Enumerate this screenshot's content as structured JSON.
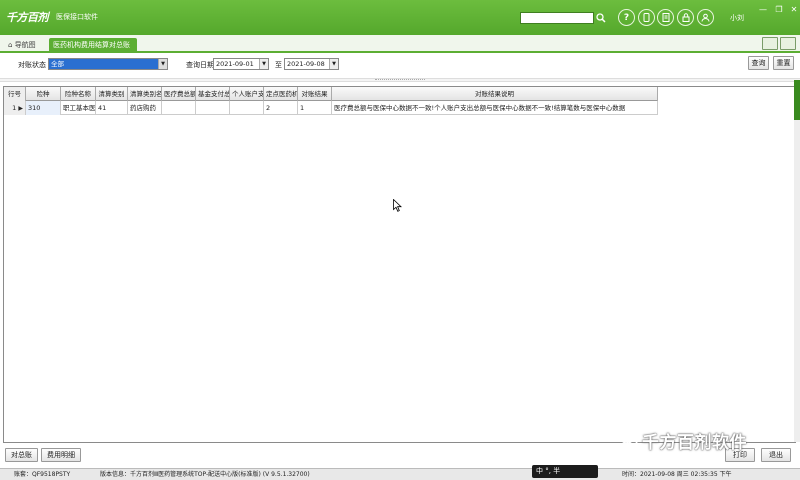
{
  "app": {
    "logo": "千方百剂",
    "subtitle": "医保接口软件",
    "user": "小刘"
  },
  "tabs": {
    "home": "导航图",
    "active": "医药机构费用结算对总账"
  },
  "filters": {
    "status_label": "对账状态",
    "status_value": "全部",
    "date_label": "查询日期",
    "date_from": "2021-09-01",
    "to_label": "至",
    "date_to": "2021-09-08",
    "query_button": "查询",
    "reset_button": "重置"
  },
  "grid": {
    "columns": [
      "行号",
      "险种",
      "险种名称",
      "清算类别",
      "清算类别名称",
      "医疗费总额",
      "基金支付总额",
      "个人账户支付总额",
      "定点医药机构结算笔数",
      "对账结果",
      "对账结果说明"
    ],
    "rows": [
      {
        "line": "1",
        "insutype": "310",
        "name": "职工基本医疗保险",
        "clr_type": "41",
        "clr_type_name": "药店购药",
        "medfee": "",
        "fund_pay": "",
        "acct_pay": "",
        "setl_cnt": "2",
        "result": "1",
        "result_desc": "医疗费总额与医保中心数据不一致!个人账户支出总额与医保中心数据不一致!结算笔数与医保中心数据"
      }
    ]
  },
  "bottom": {
    "btn_total": "对总账",
    "btn_detail": "费用明细",
    "btn_print": "打印",
    "btn_exit": "退出"
  },
  "statusbar": {
    "account": "账套：QF9518PSTY",
    "version": "版本信息：千方百剂Ⅲ医药管理系统TOP-配送中心版(标准版) (V 9.5.1.32700)",
    "time": "时间：2021-09-08 周三 02:35:35 下午",
    "ime": "中 °, 半"
  },
  "watermark": "千方百剂软件",
  "colors": {
    "brand_green": "#5cae33",
    "selected_blue": "#2a6fd1"
  }
}
